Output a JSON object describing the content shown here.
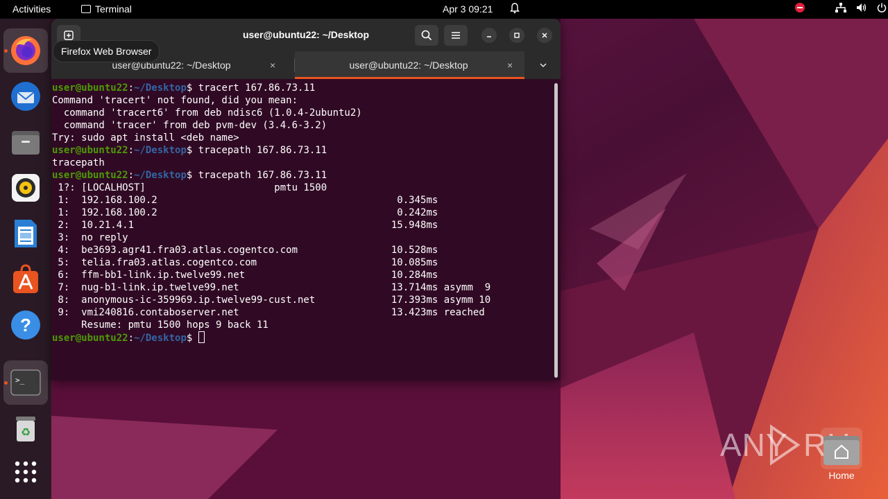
{
  "topbar": {
    "activities": "Activities",
    "app_name": "Terminal",
    "clock": "Apr 3  09:21"
  },
  "dock": {
    "tooltip": "Firefox Web Browser",
    "items": [
      "firefox",
      "thunderbird",
      "files",
      "rhythmbox",
      "libreoffice-writer",
      "app-center",
      "help",
      "terminal",
      "trash",
      "show-apps"
    ]
  },
  "window": {
    "title": "user@ubuntu22: ~/Desktop",
    "tabs": [
      {
        "label": "user@ubuntu22: ~/Desktop",
        "active": false
      },
      {
        "label": "user@ubuntu22: ~/Desktop",
        "active": true
      }
    ],
    "tab_close": "×"
  },
  "terminal": {
    "prompt_user": "user@ubuntu22",
    "prompt_path": "~/Desktop",
    "lines": [
      {
        "prompt": true,
        "text": "tracert 167.86.73.11"
      },
      {
        "prompt": false,
        "text": "Command 'tracert' not found, did you mean:"
      },
      {
        "prompt": false,
        "text": "  command 'tracert6' from deb ndisc6 (1.0.4-2ubuntu2)"
      },
      {
        "prompt": false,
        "text": "  command 'tracer' from deb pvm-dev (3.4.6-3.2)"
      },
      {
        "prompt": false,
        "text": "Try: sudo apt install <deb name>"
      },
      {
        "prompt": true,
        "text": "tracepath 167.86.73.11"
      },
      {
        "prompt": false,
        "text": "tracepath"
      },
      {
        "prompt": true,
        "text": "tracepath 167.86.73.11"
      },
      {
        "prompt": false,
        "text": " 1?: [LOCALHOST]                      pmtu 1500"
      },
      {
        "prompt": false,
        "text": " 1:  192.168.100.2                                         0.345ms"
      },
      {
        "prompt": false,
        "text": " 1:  192.168.100.2                                         0.242ms"
      },
      {
        "prompt": false,
        "text": " 2:  10.21.4.1                                            15.948ms"
      },
      {
        "prompt": false,
        "text": " 3:  no reply"
      },
      {
        "prompt": false,
        "text": " 4:  be3693.agr41.fra03.atlas.cogentco.com                10.528ms"
      },
      {
        "prompt": false,
        "text": " 5:  telia.fra03.atlas.cogentco.com                       10.085ms"
      },
      {
        "prompt": false,
        "text": " 6:  ffm-bb1-link.ip.twelve99.net                         10.284ms"
      },
      {
        "prompt": false,
        "text": " 7:  nug-b1-link.ip.twelve99.net                          13.714ms asymm  9"
      },
      {
        "prompt": false,
        "text": " 8:  anonymous-ic-359969.ip.twelve99-cust.net             17.393ms asymm 10"
      },
      {
        "prompt": false,
        "text": " 9:  vmi240816.contaboserver.net                          13.423ms reached"
      },
      {
        "prompt": false,
        "text": "     Resume: pmtu 1500 hops 9 back 11"
      },
      {
        "prompt": true,
        "text": "",
        "cursor": true
      }
    ]
  },
  "desktop": {
    "home_label": "Home",
    "watermark": "ANY RUN"
  },
  "colors": {
    "terminal_bg": "#300a24",
    "prompt_user": "#4e9a06",
    "prompt_path": "#3465a4",
    "accent": "#e95420"
  }
}
